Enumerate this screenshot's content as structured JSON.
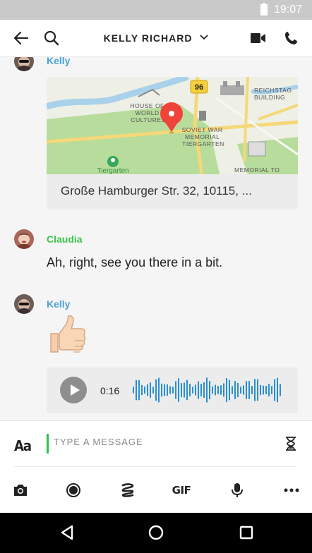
{
  "status_bar": {
    "time": "19:07"
  },
  "header": {
    "back_icon": "arrow-left-icon",
    "search_icon": "search-icon",
    "title": "KELLY RICHARD",
    "dropdown_icon": "chevron-down-icon",
    "video_icon": "video-camera-icon",
    "phone_icon": "phone-icon"
  },
  "messages": [
    {
      "sender": "Kelly",
      "sender_color": "#4aa3d8",
      "type": "location",
      "map_labels": {
        "road_number": "96",
        "house_of_world_cultures": [
          "HOUSE OF",
          "WORLD",
          "CULTURES"
        ],
        "reichstag": [
          "REICHSTAG",
          "BUILDING"
        ],
        "soviet_war_memorial": [
          "SOVIET WAR",
          "MEMORIAL",
          "TIERGARTEN"
        ],
        "tiergarten": "Tiergarten",
        "memorial_to": "MEMORIAL TO"
      },
      "address": "Große Hamburger Str. 32, 10115, ..."
    },
    {
      "sender": "Claudia",
      "sender_color": "#3ec44a",
      "type": "text",
      "text": "Ah, right, see you there in a bit."
    },
    {
      "sender": "Kelly",
      "sender_color": "#4aa3d8",
      "type": "emoji",
      "emoji": "thumbs-up"
    },
    {
      "type": "voice",
      "duration": "0:16"
    }
  ],
  "composer": {
    "format_label": "Aa",
    "placeholder": "TYPE A MESSAGE",
    "timer_icon": "hourglass-icon",
    "toolbar": [
      "camera-icon",
      "record-icon",
      "giphy-icon",
      "GIF",
      "microphone-icon",
      "more-icon"
    ]
  },
  "colors": {
    "accent_green": "#2ec24a",
    "accent_blue": "#4aa3d8",
    "waveform": "#2a8fd1"
  }
}
